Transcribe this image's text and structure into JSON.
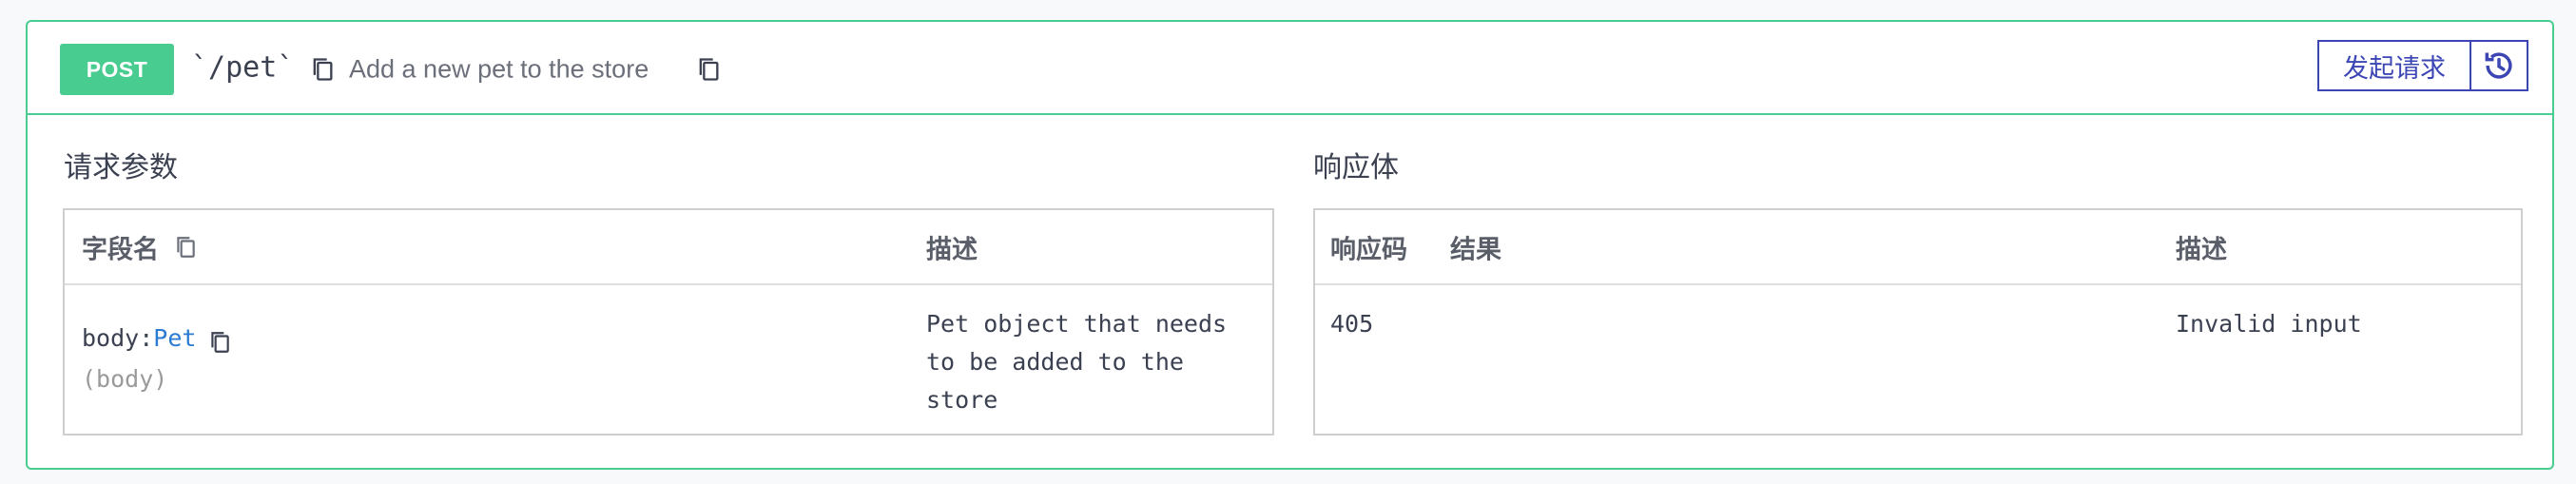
{
  "operation": {
    "method": "POST",
    "path": "`/pet`",
    "summary": "Add a new pet to the store",
    "try_button_label": "发起请求",
    "history_icon": "history-icon",
    "accent_color": "#49cc90"
  },
  "request": {
    "title": "请求参数",
    "columns": {
      "name": "字段名",
      "description": "描述"
    },
    "rows": [
      {
        "name_prefix": "body:",
        "type": "Pet",
        "location": "(body)",
        "description_lines": [
          "Pet object that needs",
          "to be added to the",
          "store"
        ]
      }
    ]
  },
  "response": {
    "title": "响应体",
    "columns": {
      "code": "响应码",
      "result": "结果",
      "description": "描述"
    },
    "rows": [
      {
        "code": "405",
        "result": "",
        "description": "Invalid input"
      }
    ]
  }
}
